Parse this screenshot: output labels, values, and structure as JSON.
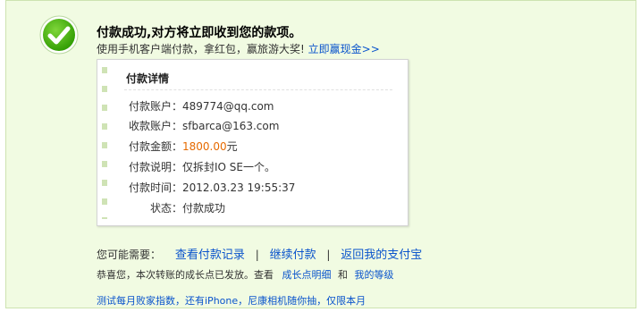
{
  "header": {
    "title": "付款成功,对方将立即收到您的款项。",
    "subtitle_text": "使用手机客户端付款，拿红包，赢旅游大奖!",
    "subtitle_link": "立即赢现金>>"
  },
  "icons": {
    "status": "check-circle-icon"
  },
  "colors": {
    "accent": "#0a54cc",
    "success": "#3aa000",
    "amount": "#e66a00"
  },
  "details": {
    "title": "付款详情",
    "rows": [
      {
        "label": "付款账户：",
        "value": "489774@qq.com"
      },
      {
        "label": "收款账户：",
        "value": "sfbarca@163.com"
      },
      {
        "label": "付款金额：",
        "amount": "1800.00",
        "unit": "元"
      },
      {
        "label": "付款说明：",
        "value": "仅拆封IO SE一个。"
      },
      {
        "label": "付款时间：",
        "value": "2012.03.23 19:55:37"
      },
      {
        "label": "状态：",
        "value": "付款成功"
      }
    ]
  },
  "links": {
    "prefix": "您可能需要：",
    "view_records": "查看付款记录",
    "continue_pay": "继续付款",
    "back_alipay": "返回我的支付宝",
    "divider": "|"
  },
  "growth": {
    "text": "恭喜您，本次转账的成长点已发放。查看",
    "link1": "成长点明细",
    "and": "和",
    "link2": "我的等级"
  },
  "promo": {
    "text": "测试每月败家指数，还有iPhone，尼康相机随你抽，仅限本月"
  }
}
